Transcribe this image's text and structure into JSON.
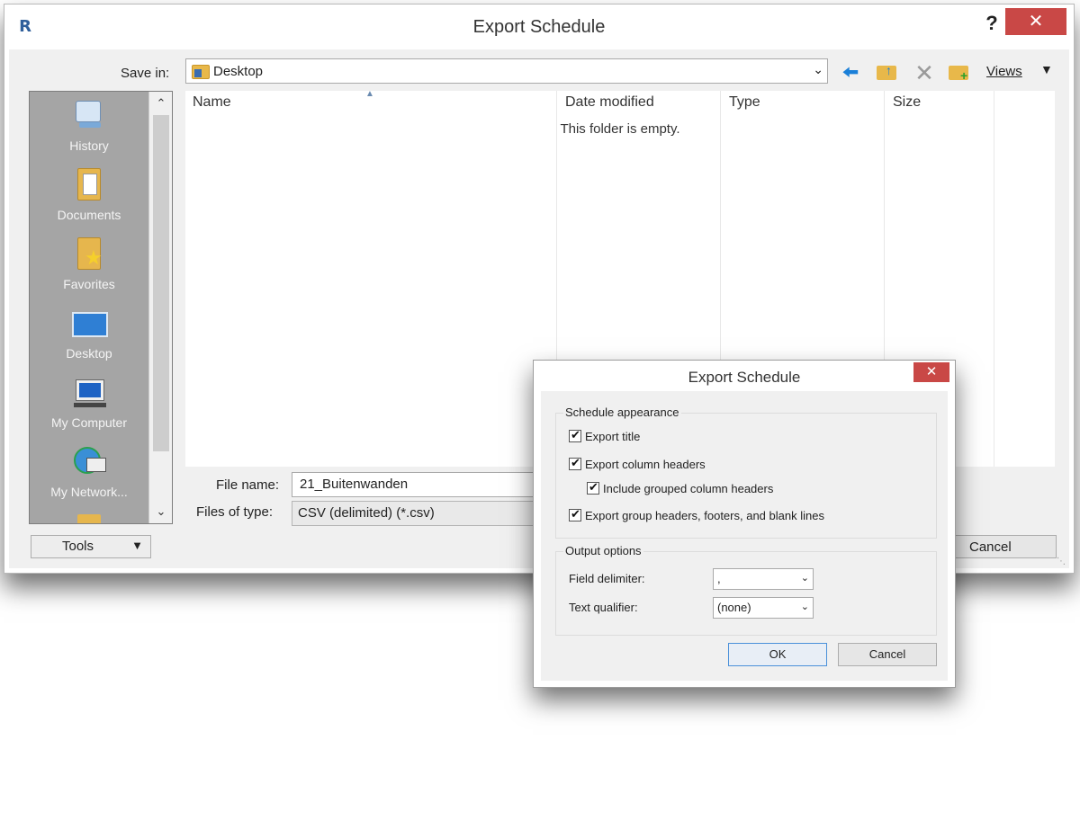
{
  "main_dialog": {
    "title": "Export Schedule",
    "help_label": "?",
    "close_label": "✕",
    "save_in_label": "Save in:",
    "save_in_value": "Desktop",
    "views_label": "Views",
    "places": [
      "History",
      "Documents",
      "Favorites",
      "Desktop",
      "My Computer",
      "My Network..."
    ],
    "columns": [
      "Name",
      "Date modified",
      "Type",
      "Size"
    ],
    "empty_message": "This folder is empty.",
    "file_name_label": "File name:",
    "file_name_value": "21_Buitenwanden",
    "files_of_type_label": "Files of type:",
    "files_of_type_value": "CSV (delimited)  (*.csv)",
    "tools_label": "Tools",
    "cancel_label": "Cancel"
  },
  "options_dialog": {
    "title": "Export Schedule",
    "close_label": "✕",
    "appearance_group": "Schedule appearance",
    "export_title": "Export title",
    "export_column_headers": "Export column headers",
    "include_grouped": "Include grouped column headers",
    "export_group_headers": "Export group headers, footers, and blank lines",
    "output_group": "Output options",
    "field_delimiter_label": "Field delimiter:",
    "field_delimiter_value": ",",
    "text_qualifier_label": "Text qualifier:",
    "text_qualifier_value": "(none)",
    "ok_label": "OK",
    "cancel_label": "Cancel"
  }
}
